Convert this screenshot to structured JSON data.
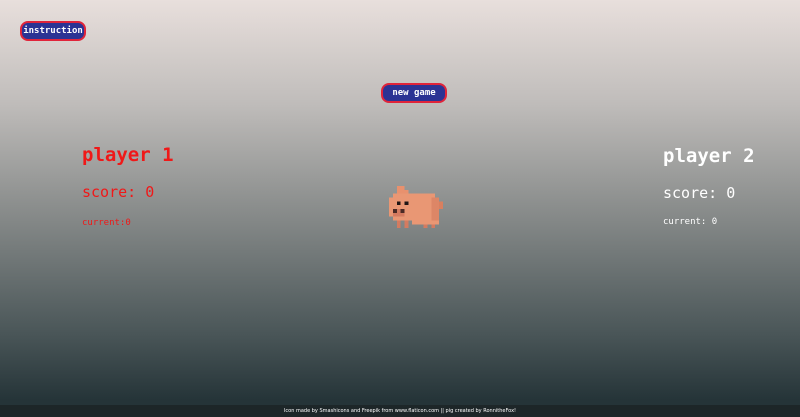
{
  "buttons": {
    "instruction": "instruction",
    "new_game": "new game"
  },
  "player1": {
    "name": "player 1",
    "score": "score: 0",
    "current": "current:0",
    "color": "#f01818"
  },
  "player2": {
    "name": "player 2",
    "score": "score: 0",
    "current": "current: 0",
    "color": "#ffffff"
  },
  "mascot": {
    "icon": "pig-icon"
  },
  "footer": {
    "credits": "Icon made by Smashicons and Freepik from www.flaticon.com || pig created by RonnitheFox!"
  }
}
